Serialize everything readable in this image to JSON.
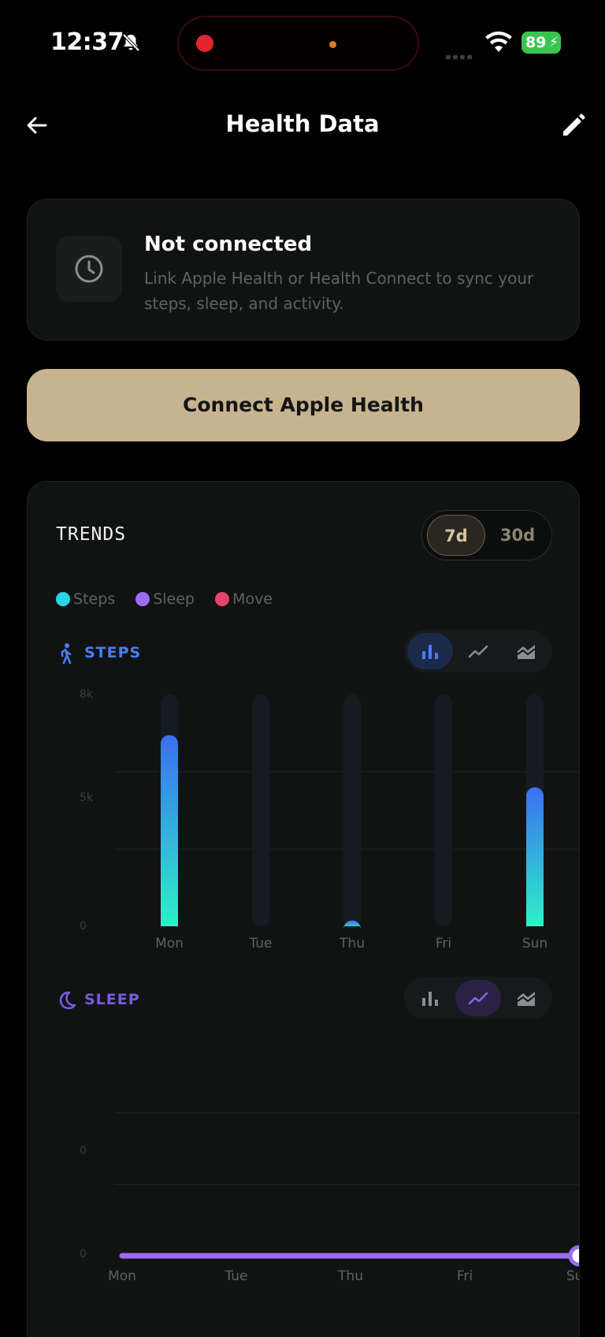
{
  "status_bar": {
    "time": "12:37",
    "battery": "89"
  },
  "header": {
    "title": "Health Data"
  },
  "connection": {
    "title": "Not connected",
    "description": "Link Apple Health or Health Connect to sync your steps, sleep, and activity.",
    "button_label": "Connect Apple Health"
  },
  "trends": {
    "title": "TRENDS",
    "ranges": [
      "7d",
      "30d"
    ],
    "selected_range": "7d",
    "legend": [
      {
        "name": "Steps",
        "color": "#2ad6e6"
      },
      {
        "name": "Sleep",
        "color": "#9b6cf0"
      },
      {
        "name": "Move",
        "color": "#e8436a"
      }
    ]
  },
  "steps": {
    "label": "STEPS",
    "selected_view": "bar"
  },
  "sleep": {
    "label": "SLEEP",
    "selected_view": "line"
  },
  "chart_data": [
    {
      "type": "bar",
      "title": "STEPS",
      "categories": [
        "Mon",
        "Tue",
        "Thu",
        "Fri",
        "Sun"
      ],
      "values": [
        6.6,
        0,
        0.2,
        0,
        4.8
      ],
      "ytick_labels": [
        "8k",
        "5k",
        "0"
      ],
      "ylim": [
        0,
        8
      ],
      "grid": true
    },
    {
      "type": "line",
      "title": "SLEEP",
      "categories": [
        "Mon",
        "Tue",
        "Thu",
        "Fri",
        "Sun"
      ],
      "values": [
        0,
        0,
        0,
        0,
        0
      ],
      "ytick_labels": [
        "",
        "0",
        "0"
      ],
      "grid": true
    }
  ],
  "colors": {
    "accent": "#c8b391",
    "steps_top": "#3a6ff0",
    "steps_bottom": "#2ef0c8",
    "sleep": "#9b6cf0",
    "steps_label": "#4a7cf6",
    "sleep_label": "#7b58e6"
  }
}
